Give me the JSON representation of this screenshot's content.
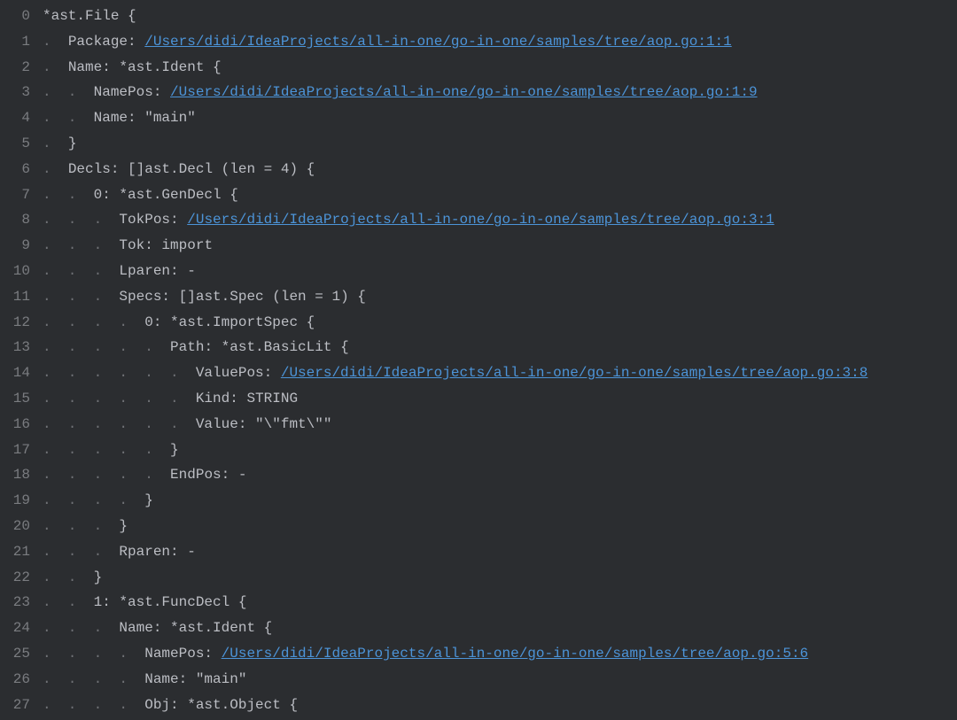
{
  "lines": [
    {
      "n": 0,
      "indent": 0,
      "segments": [
        {
          "type": "text",
          "v": "*ast.File {"
        }
      ]
    },
    {
      "n": 1,
      "indent": 1,
      "segments": [
        {
          "type": "text",
          "v": "Package: "
        },
        {
          "type": "link",
          "v": "/Users/didi/IdeaProjects/all-in-one/go-in-one/samples/tree/aop.go:1:1"
        }
      ]
    },
    {
      "n": 2,
      "indent": 1,
      "segments": [
        {
          "type": "text",
          "v": "Name: *ast.Ident {"
        }
      ]
    },
    {
      "n": 3,
      "indent": 2,
      "segments": [
        {
          "type": "text",
          "v": "NamePos: "
        },
        {
          "type": "link",
          "v": "/Users/didi/IdeaProjects/all-in-one/go-in-one/samples/tree/aop.go:1:9"
        }
      ]
    },
    {
      "n": 4,
      "indent": 2,
      "segments": [
        {
          "type": "text",
          "v": "Name: \"main\""
        }
      ]
    },
    {
      "n": 5,
      "indent": 1,
      "segments": [
        {
          "type": "text",
          "v": "}"
        }
      ]
    },
    {
      "n": 6,
      "indent": 1,
      "segments": [
        {
          "type": "text",
          "v": "Decls: []ast.Decl (len = 4) {"
        }
      ]
    },
    {
      "n": 7,
      "indent": 2,
      "segments": [
        {
          "type": "text",
          "v": "0: *ast.GenDecl {"
        }
      ]
    },
    {
      "n": 8,
      "indent": 3,
      "segments": [
        {
          "type": "text",
          "v": "TokPos: "
        },
        {
          "type": "link",
          "v": "/Users/didi/IdeaProjects/all-in-one/go-in-one/samples/tree/aop.go:3:1"
        }
      ]
    },
    {
      "n": 9,
      "indent": 3,
      "segments": [
        {
          "type": "text",
          "v": "Tok: import"
        }
      ]
    },
    {
      "n": 10,
      "indent": 3,
      "segments": [
        {
          "type": "text",
          "v": "Lparen: -"
        }
      ]
    },
    {
      "n": 11,
      "indent": 3,
      "segments": [
        {
          "type": "text",
          "v": "Specs: []ast.Spec (len = 1) {"
        }
      ]
    },
    {
      "n": 12,
      "indent": 4,
      "segments": [
        {
          "type": "text",
          "v": "0: *ast.ImportSpec {"
        }
      ]
    },
    {
      "n": 13,
      "indent": 5,
      "segments": [
        {
          "type": "text",
          "v": "Path: *ast.BasicLit {"
        }
      ]
    },
    {
      "n": 14,
      "indent": 6,
      "segments": [
        {
          "type": "text",
          "v": "ValuePos: "
        },
        {
          "type": "link",
          "v": "/Users/didi/IdeaProjects/all-in-one/go-in-one/samples/tree/aop.go:3:8"
        }
      ]
    },
    {
      "n": 15,
      "indent": 6,
      "segments": [
        {
          "type": "text",
          "v": "Kind: STRING"
        }
      ]
    },
    {
      "n": 16,
      "indent": 6,
      "segments": [
        {
          "type": "text",
          "v": "Value: \"\\\"fmt\\\"\""
        }
      ]
    },
    {
      "n": 17,
      "indent": 5,
      "segments": [
        {
          "type": "text",
          "v": "}"
        }
      ]
    },
    {
      "n": 18,
      "indent": 5,
      "segments": [
        {
          "type": "text",
          "v": "EndPos: -"
        }
      ]
    },
    {
      "n": 19,
      "indent": 4,
      "segments": [
        {
          "type": "text",
          "v": "}"
        }
      ]
    },
    {
      "n": 20,
      "indent": 3,
      "segments": [
        {
          "type": "text",
          "v": "}"
        }
      ]
    },
    {
      "n": 21,
      "indent": 3,
      "segments": [
        {
          "type": "text",
          "v": "Rparen: -"
        }
      ]
    },
    {
      "n": 22,
      "indent": 2,
      "segments": [
        {
          "type": "text",
          "v": "}"
        }
      ]
    },
    {
      "n": 23,
      "indent": 2,
      "segments": [
        {
          "type": "text",
          "v": "1: *ast.FuncDecl {"
        }
      ]
    },
    {
      "n": 24,
      "indent": 3,
      "segments": [
        {
          "type": "text",
          "v": "Name: *ast.Ident {"
        }
      ]
    },
    {
      "n": 25,
      "indent": 4,
      "segments": [
        {
          "type": "text",
          "v": "NamePos: "
        },
        {
          "type": "link",
          "v": "/Users/didi/IdeaProjects/all-in-one/go-in-one/samples/tree/aop.go:5:6"
        }
      ]
    },
    {
      "n": 26,
      "indent": 4,
      "segments": [
        {
          "type": "text",
          "v": "Name: \"main\""
        }
      ]
    },
    {
      "n": 27,
      "indent": 4,
      "segments": [
        {
          "type": "text",
          "v": "Obj: *ast.Object {"
        }
      ]
    }
  ]
}
